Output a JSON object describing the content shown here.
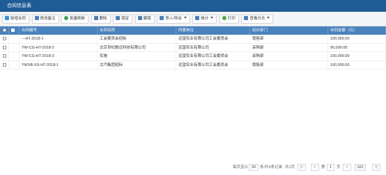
{
  "window": {
    "title": "合同信息表"
  },
  "toolbar": {
    "buttons": [
      {
        "label": "新增合同",
        "icon": "add-icon",
        "color": "#3d8ed8"
      },
      {
        "label": "修改备注",
        "icon": "edit-icon",
        "color": "#4a7fb8"
      },
      {
        "label": "批量刷新",
        "icon": "refresh-icon",
        "color": "#3aa35b"
      },
      {
        "label": "删除",
        "icon": "delete-icon",
        "color": "#4a7fb8"
      },
      {
        "label": "锁定",
        "icon": "lock-icon",
        "color": "#4a7fb8"
      },
      {
        "label": "解锁",
        "icon": "unlock-icon",
        "color": "#4a7fb8"
      },
      {
        "label": "导入/导出",
        "icon": "import-export-icon",
        "color": "#4a7fb8"
      },
      {
        "label": "统计",
        "icon": "statistics-icon",
        "color": "#4a7fb8"
      },
      {
        "label": "打印",
        "icon": "print-icon",
        "color": "#4aa843"
      },
      {
        "label": "查看日志",
        "icon": "log-icon",
        "color": "#4a7fb8"
      }
    ]
  },
  "table": {
    "columns": [
      "合同编号",
      "合同名称",
      "所属单位",
      "经办部门",
      "合同金额（元）"
    ],
    "rows": [
      {
        "code": "---HT-2018-1",
        "name": "工会委员会招标",
        "unit": "远望实业有限公司工会委员会",
        "dept": "销售部",
        "amount": "100,000.00"
      },
      {
        "code": "YW-CG-HT-2018-2",
        "name": "北京世纪数远科技有限公司",
        "unit": "远望实业有限公司",
        "dept": "采购部",
        "amount": "90,000.00"
      },
      {
        "code": "YW-CG-HT-2018-3",
        "name": "实施",
        "unit": "远望实业有限公司工会委员会",
        "dept": "采购部",
        "amount": "100,000.00"
      },
      {
        "code": "YWXB-XS-HT-2018-1",
        "name": "北汽集团招标",
        "unit": "远望实业有限公司工会委员会",
        "dept": "销售部",
        "amount": "100,000.00"
      }
    ]
  },
  "pager": {
    "per_page_label": "每页显示",
    "page_size": "20",
    "records_text": "条/共4条记录",
    "total_pages_text": "共1页",
    "page_prefix": "第",
    "current_page": "1",
    "page_suffix": "页",
    "go_label": "GO",
    "first_symbol": "|<",
    "prev_symbol": "<",
    "next_symbol": ">",
    "last_symbol": ">|"
  }
}
